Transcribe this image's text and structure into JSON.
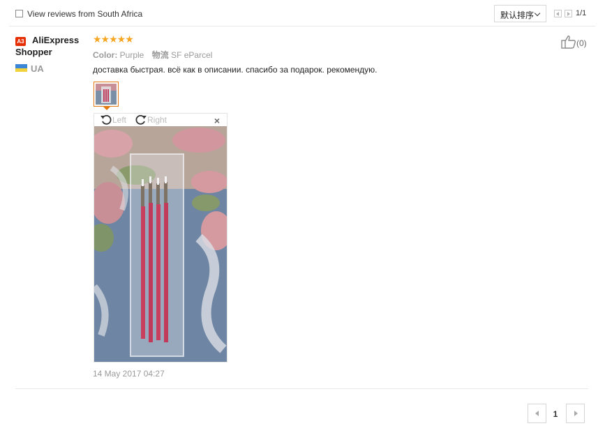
{
  "filter": {
    "checkbox_label": "View reviews from South Africa",
    "checked": false,
    "sort_label": "默认排序",
    "page_indicator": "1/1"
  },
  "review": {
    "badge": "A3",
    "user_name": "AliExpress Shopper",
    "country": "UA",
    "rating": 5,
    "stars": "★★★★★",
    "color_key": "Color:",
    "color_value": "Purple",
    "shipping_key": "物流",
    "shipping_value": "SF eParcel",
    "text": "доставка быстрая. всё как в описании. спасибо за подарок. рекомендую.",
    "date": "14 May 2017 04:27",
    "likes": "(0)"
  },
  "viewer": {
    "rotate_left": "Left",
    "rotate_right": "Right",
    "close": "×"
  },
  "pagination": {
    "current_page": "1"
  },
  "colors": {
    "accent": "#e07a10",
    "badge": "#e62e04",
    "star": "#f5a623"
  },
  "icons": [
    "checkbox",
    "chevron-down-icon",
    "prev-page-icon",
    "next-page-icon",
    "thumbs-up-icon",
    "rotate-left-icon",
    "rotate-right-icon",
    "close-icon",
    "flag-ua-icon"
  ]
}
